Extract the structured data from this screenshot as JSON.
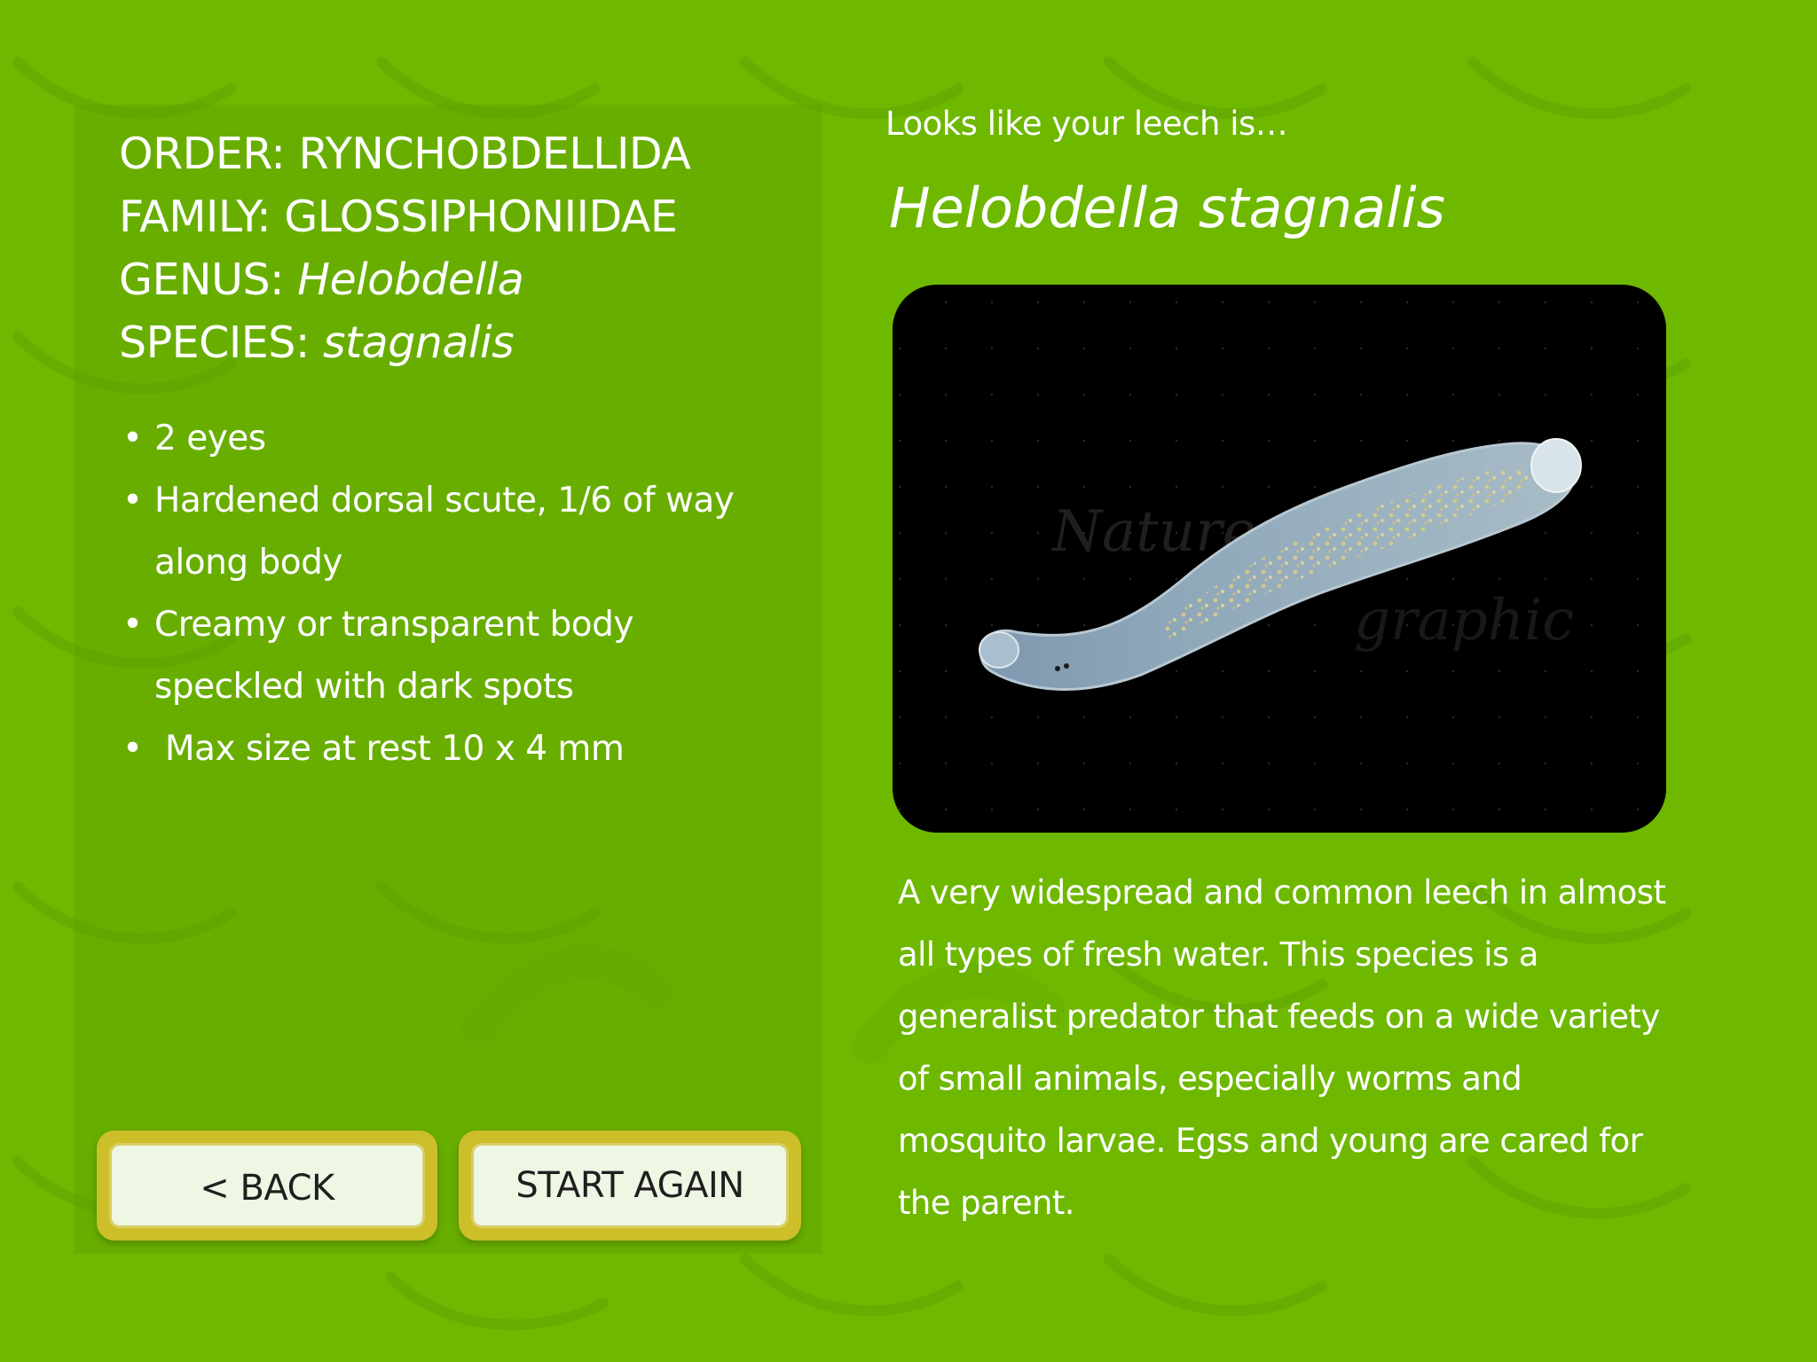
{
  "taxonomy": {
    "order_label": "ORDER: ",
    "order": "RYNCHOBDELLIDA",
    "family_label": "FAMILY: ",
    "family": "GLOSSIPHONIIDAE",
    "genus_label": "GENUS: ",
    "genus": "Helobdella",
    "species_label": "SPECIES: ",
    "species": "stagnalis"
  },
  "traits": [
    {
      "bullet": "•",
      "text": "2 eyes"
    },
    {
      "bullet": "•",
      "text": "Hardened dorsal scute, 1/6 of way along body"
    },
    {
      "bullet": "•",
      "text": "Creamy or transparent body speckled with dark spots"
    },
    {
      "bullet": "•",
      "text": " Max size at rest 10 x 4 mm"
    }
  ],
  "buttons": {
    "back": "< BACK",
    "start_again": "START AGAIN"
  },
  "result": {
    "intro": "Looks like your leech is…",
    "species_name": "Helobdella stagnalis",
    "description": "A very widespread and common leech in almost all types of fresh water. This species is a generalist predator that feeds on a wide variety of small animals, especially worms and mosquito larvae. Egss and young are cared for the parent."
  },
  "photo": {
    "watermark_text": "Naturegraphic",
    "icon": "leech-photo"
  },
  "colors": {
    "background": "#6eb800",
    "panel": "#5a9600",
    "button_border": "#cdbf2a",
    "button_face": "#eef6e4",
    "photo_bg": "#000000",
    "text": "#ffffff"
  }
}
